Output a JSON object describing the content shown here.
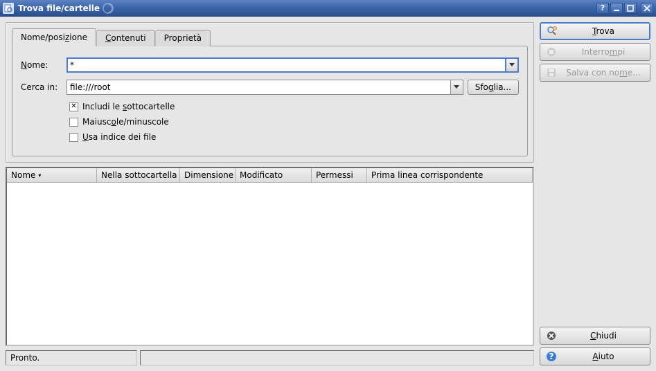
{
  "titlebar": {
    "title": "Trova file/cartelle"
  },
  "tabs": {
    "name_pos": "Nome/posizione",
    "contents": "Contenuti",
    "properties": "Proprietà"
  },
  "form": {
    "name_label": "Nome:",
    "name_value": "*",
    "search_in_label": "Cerca in:",
    "search_in_value": "file:///root",
    "browse_btn": "Sfoglia...",
    "include_subfolders": "Includi le sottocartelle",
    "case_sensitive": "Maiuscole/minuscole",
    "use_index": "Usa indice dei file"
  },
  "columns": {
    "name": "Nome",
    "subfolder": "Nella sottocartella",
    "size": "Dimensione",
    "modified": "Modificato",
    "permissions": "Permessi",
    "first_match": "Prima linea corrispondente"
  },
  "status": {
    "ready": "Pronto."
  },
  "actions": {
    "find": "Trova",
    "stop": "Interrompi",
    "save_as": "Salva con nome...",
    "close": "Chiudi",
    "help": "Aiuto"
  }
}
